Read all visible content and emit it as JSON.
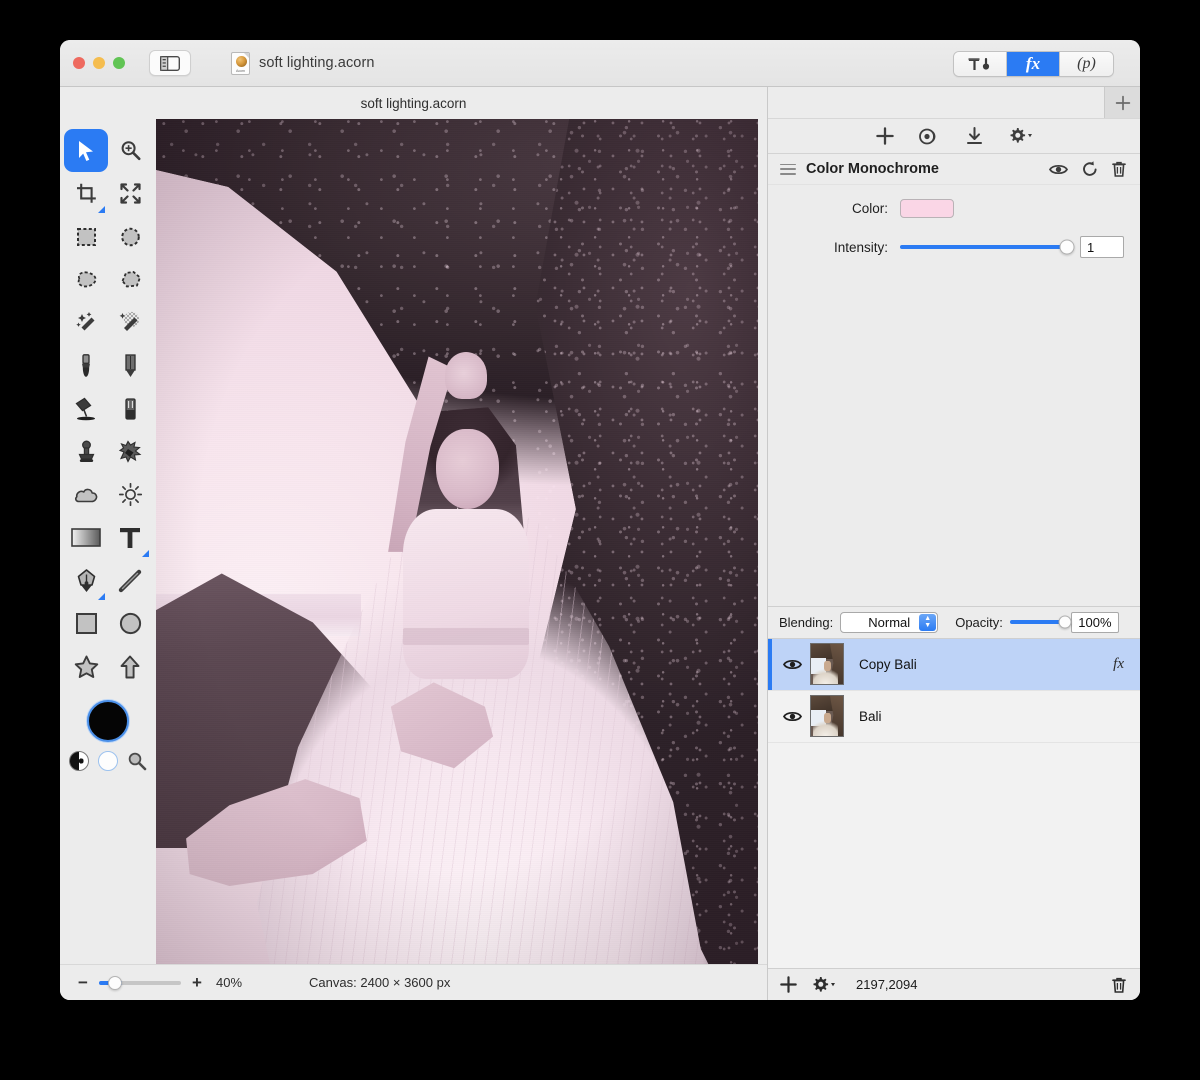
{
  "window": {
    "traffic_lights": [
      "close",
      "minimize",
      "zoom"
    ],
    "document_title": "soft lighting.acorn",
    "doc_icon_word": "Acorn",
    "sidebar_toggle_icon": "sidebar-toggle-icon"
  },
  "mode_segmented": {
    "buttons": [
      {
        "id": "tools",
        "icon": "hammer-tools-icon",
        "label": "",
        "active": false
      },
      {
        "id": "filters",
        "icon": "fx-icon",
        "label": "fx",
        "active": true
      },
      {
        "id": "presets",
        "icon": "p-parens-icon",
        "label": "(p)",
        "active": false
      }
    ]
  },
  "canvas": {
    "tab_title": "soft lighting.acorn",
    "zoom_minus": "−",
    "zoom_plus": "+",
    "zoom_percent": "40%",
    "zoom_slider_value": 20,
    "canvas_size_label": "Canvas: 2400 × 3600 px"
  },
  "tools": {
    "items": [
      {
        "name": "move-tool",
        "icon": "arrow-cursor-icon",
        "selected": true,
        "has_corner": false
      },
      {
        "name": "zoom-tool",
        "icon": "magnifier-plus-icon",
        "selected": false,
        "has_corner": false
      },
      {
        "name": "crop-tool",
        "icon": "crop-icon",
        "selected": false,
        "has_corner": true
      },
      {
        "name": "transform-tool",
        "icon": "arrows-expand-icon",
        "selected": false,
        "has_corner": false
      },
      {
        "name": "rectangular-select-tool",
        "icon": "marquee-rect-icon",
        "selected": false,
        "has_corner": false
      },
      {
        "name": "elliptical-select-tool",
        "icon": "marquee-ellipse-icon",
        "selected": false,
        "has_corner": false
      },
      {
        "name": "lasso-select-tool",
        "icon": "lasso-icon",
        "selected": false,
        "has_corner": false
      },
      {
        "name": "polygon-select-tool",
        "icon": "polygon-lasso-icon",
        "selected": false,
        "has_corner": false
      },
      {
        "name": "magic-wand-tool",
        "icon": "magic-wand-icon",
        "selected": false,
        "has_corner": false
      },
      {
        "name": "instant-alpha-tool",
        "icon": "magic-wand-alpha-icon",
        "selected": false,
        "has_corner": false
      },
      {
        "name": "brush-tool",
        "icon": "paint-brush-icon",
        "selected": false,
        "has_corner": false
      },
      {
        "name": "pencil-tool",
        "icon": "pencil-icon",
        "selected": false,
        "has_corner": false
      },
      {
        "name": "paint-bucket-tool",
        "icon": "paint-bucket-icon",
        "selected": false,
        "has_corner": false
      },
      {
        "name": "eraser-tool",
        "icon": "eraser-icon",
        "selected": false,
        "has_corner": false
      },
      {
        "name": "clone-stamp-tool",
        "icon": "clone-stamp-icon",
        "selected": false,
        "has_corner": false
      },
      {
        "name": "smudge-tool",
        "icon": "smudge-splat-icon",
        "selected": false,
        "has_corner": false
      },
      {
        "name": "blur-tool",
        "icon": "cloud-blur-icon",
        "selected": false,
        "has_corner": false
      },
      {
        "name": "dodge-burn-tool",
        "icon": "sun-dodge-icon",
        "selected": false,
        "has_corner": false
      },
      {
        "name": "gradient-tool",
        "icon": "gradient-rect-icon",
        "selected": false,
        "has_corner": false
      },
      {
        "name": "text-tool",
        "icon": "text-t-icon",
        "selected": false,
        "has_corner": true
      },
      {
        "name": "bezier-pen-tool",
        "icon": "pen-nib-icon",
        "selected": false,
        "has_corner": true
      },
      {
        "name": "line-tool",
        "icon": "line-diagonal-icon",
        "selected": false,
        "has_corner": false
      },
      {
        "name": "rectangle-shape-tool",
        "icon": "square-shape-icon",
        "selected": false,
        "has_corner": false
      },
      {
        "name": "ellipse-shape-tool",
        "icon": "circle-shape-icon",
        "selected": false,
        "has_corner": false
      },
      {
        "name": "star-shape-tool",
        "icon": "star-shape-icon",
        "selected": false,
        "has_corner": false
      },
      {
        "name": "arrow-shape-tool",
        "icon": "arrow-up-shape-icon",
        "selected": false,
        "has_corner": false
      }
    ],
    "foreground_color": "#050505",
    "swatches": [
      {
        "name": "swap-black-white-swatch",
        "icon": "black-white-circle-icon"
      },
      {
        "name": "background-color-swatch",
        "icon": "white-circle-icon"
      },
      {
        "name": "color-picker-loupe",
        "icon": "magnifier-icon"
      }
    ]
  },
  "inspector": {
    "add_tab_icon": "plus-icon",
    "filter_toolbar": [
      {
        "name": "add-filter-button",
        "icon": "plus-icon"
      },
      {
        "name": "filter-mask-button",
        "icon": "mask-circles-icon"
      },
      {
        "name": "download-preset-button",
        "icon": "download-arrow-icon"
      },
      {
        "name": "filter-settings-menu",
        "icon": "gear-dropdown-icon"
      }
    ],
    "filter": {
      "grip_icon": "drag-handle-icon",
      "name": "Color Monochrome",
      "actions": [
        {
          "name": "toggle-filter-visibility",
          "icon": "eye-icon"
        },
        {
          "name": "reset-filter-button",
          "icon": "reset-arrow-icon"
        },
        {
          "name": "delete-filter-button",
          "icon": "trash-icon"
        }
      ],
      "controls": [
        {
          "type": "color",
          "label": "Color:",
          "value_hex": "#fad6e6"
        },
        {
          "type": "slider",
          "label": "Intensity:",
          "value": "1",
          "slider_fill_percent": 100
        }
      ]
    }
  },
  "layers_panel": {
    "blending_label": "Blending:",
    "blending_value": "Normal",
    "opacity_label": "Opacity:",
    "opacity_value": "100%",
    "opacity_slider_percent": 100,
    "rows": [
      {
        "name": "Copy Bali",
        "visible": true,
        "selected": true,
        "has_fx": true,
        "fx_label": "fx",
        "eye_icon": "eye-icon",
        "thumb": "layer-thumbnail"
      },
      {
        "name": "Bali",
        "visible": true,
        "selected": false,
        "has_fx": false,
        "fx_label": "",
        "eye_icon": "eye-icon",
        "thumb": "layer-thumbnail"
      }
    ],
    "footer": {
      "add_layer_icon": "plus-icon",
      "layer_settings_icon": "gear-dropdown-icon",
      "pointer_coords": "2197,2094",
      "delete_layer_icon": "trash-icon"
    }
  },
  "colors": {
    "accent_blue": "#2b7bf3",
    "selection_blue": "#bed3f7",
    "chrome_gray": "#ececec",
    "filter_pink": "#fad6e6"
  }
}
